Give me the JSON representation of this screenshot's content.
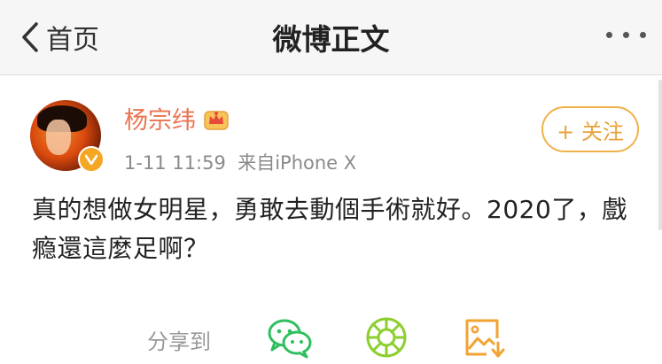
{
  "header": {
    "back_label": "首页",
    "title": "微博正文"
  },
  "post": {
    "author_name": "杨宗纬",
    "timestamp": "1-11 11:59",
    "source": "来自iPhone X",
    "follow_label": "+ 关注",
    "text": "真的想做女明星，勇敢去動個手術就好。2020了，戲瘾還這麼足啊？"
  },
  "share": {
    "label": "分享到"
  },
  "colors": {
    "header_bg": "#f6f6f6",
    "author_name": "#eb7350",
    "follow_border": "#f0b14a",
    "wechat_green": "#2fbf5e",
    "moments_green": "#8ccf2e",
    "save_orange": "#f2a332"
  },
  "icons": {
    "back": "chevron-left-icon",
    "more": "more-dots-icon",
    "crown": "crown-badge-icon",
    "verified": "verified-badge-icon",
    "wechat": "wechat-icon",
    "moments": "moments-icon",
    "save": "save-image-icon"
  }
}
